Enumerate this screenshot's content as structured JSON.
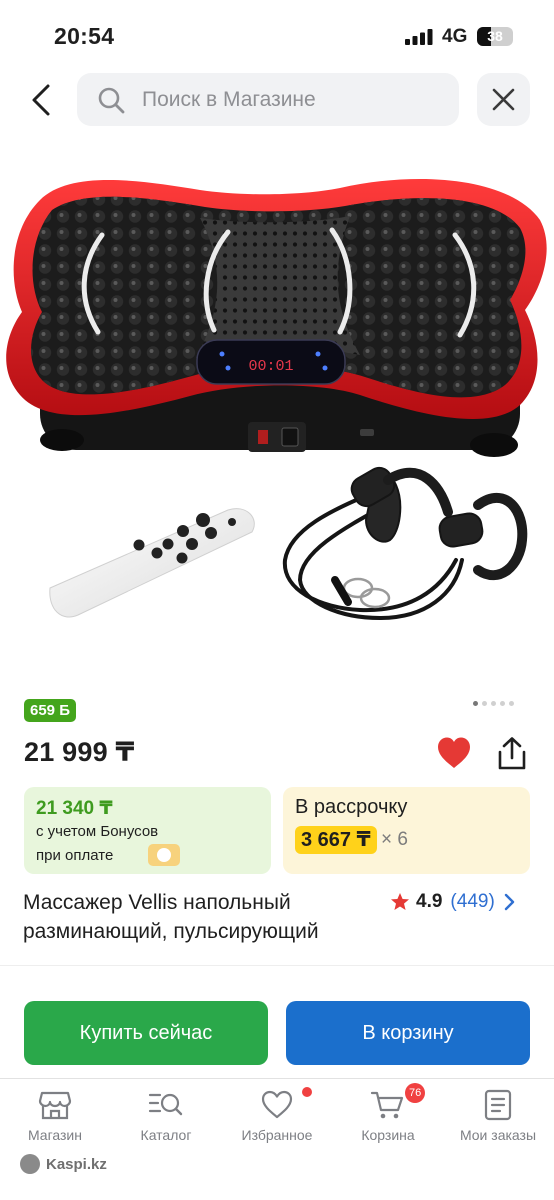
{
  "status_bar": {
    "time": "20:54",
    "network": "4G",
    "battery": "38"
  },
  "header": {
    "search_placeholder": "Поиск в Магазине"
  },
  "product": {
    "bonus_badge": "659 Б",
    "price": "21 999 ₸",
    "bonus_offer": {
      "amount": "21 340 ₸",
      "line1": "с учетом Бонусов",
      "line2": "при оплате"
    },
    "installment": {
      "title": "В рассрочку",
      "amount": "3 667 ₸",
      "multiplier": "× 6"
    },
    "title": "Массажер Vellis напольный разминающий, пульсирующий",
    "rating": {
      "value": "4.9",
      "count": "(449)"
    },
    "display_readout": "00:01",
    "image_count": 5
  },
  "actions": {
    "buy_now": "Купить сейчас",
    "add_to_cart": "В корзину"
  },
  "bottom_nav": {
    "items": [
      {
        "label": "Магазин",
        "icon": "store-icon"
      },
      {
        "label": "Каталог",
        "icon": "catalog-search-icon"
      },
      {
        "label": "Избранное",
        "icon": "heart-outline-icon"
      },
      {
        "label": "Корзина",
        "icon": "cart-icon",
        "badge": "76"
      },
      {
        "label": "Мои заказы",
        "icon": "orders-icon"
      }
    ]
  },
  "watermark": "Kaspi.kz",
  "colors": {
    "green": "#2aa84a",
    "blue": "#1b6fcc",
    "badge_green": "#44a51c",
    "heart": "#e53935",
    "installment_yellow": "#ffd21a"
  }
}
